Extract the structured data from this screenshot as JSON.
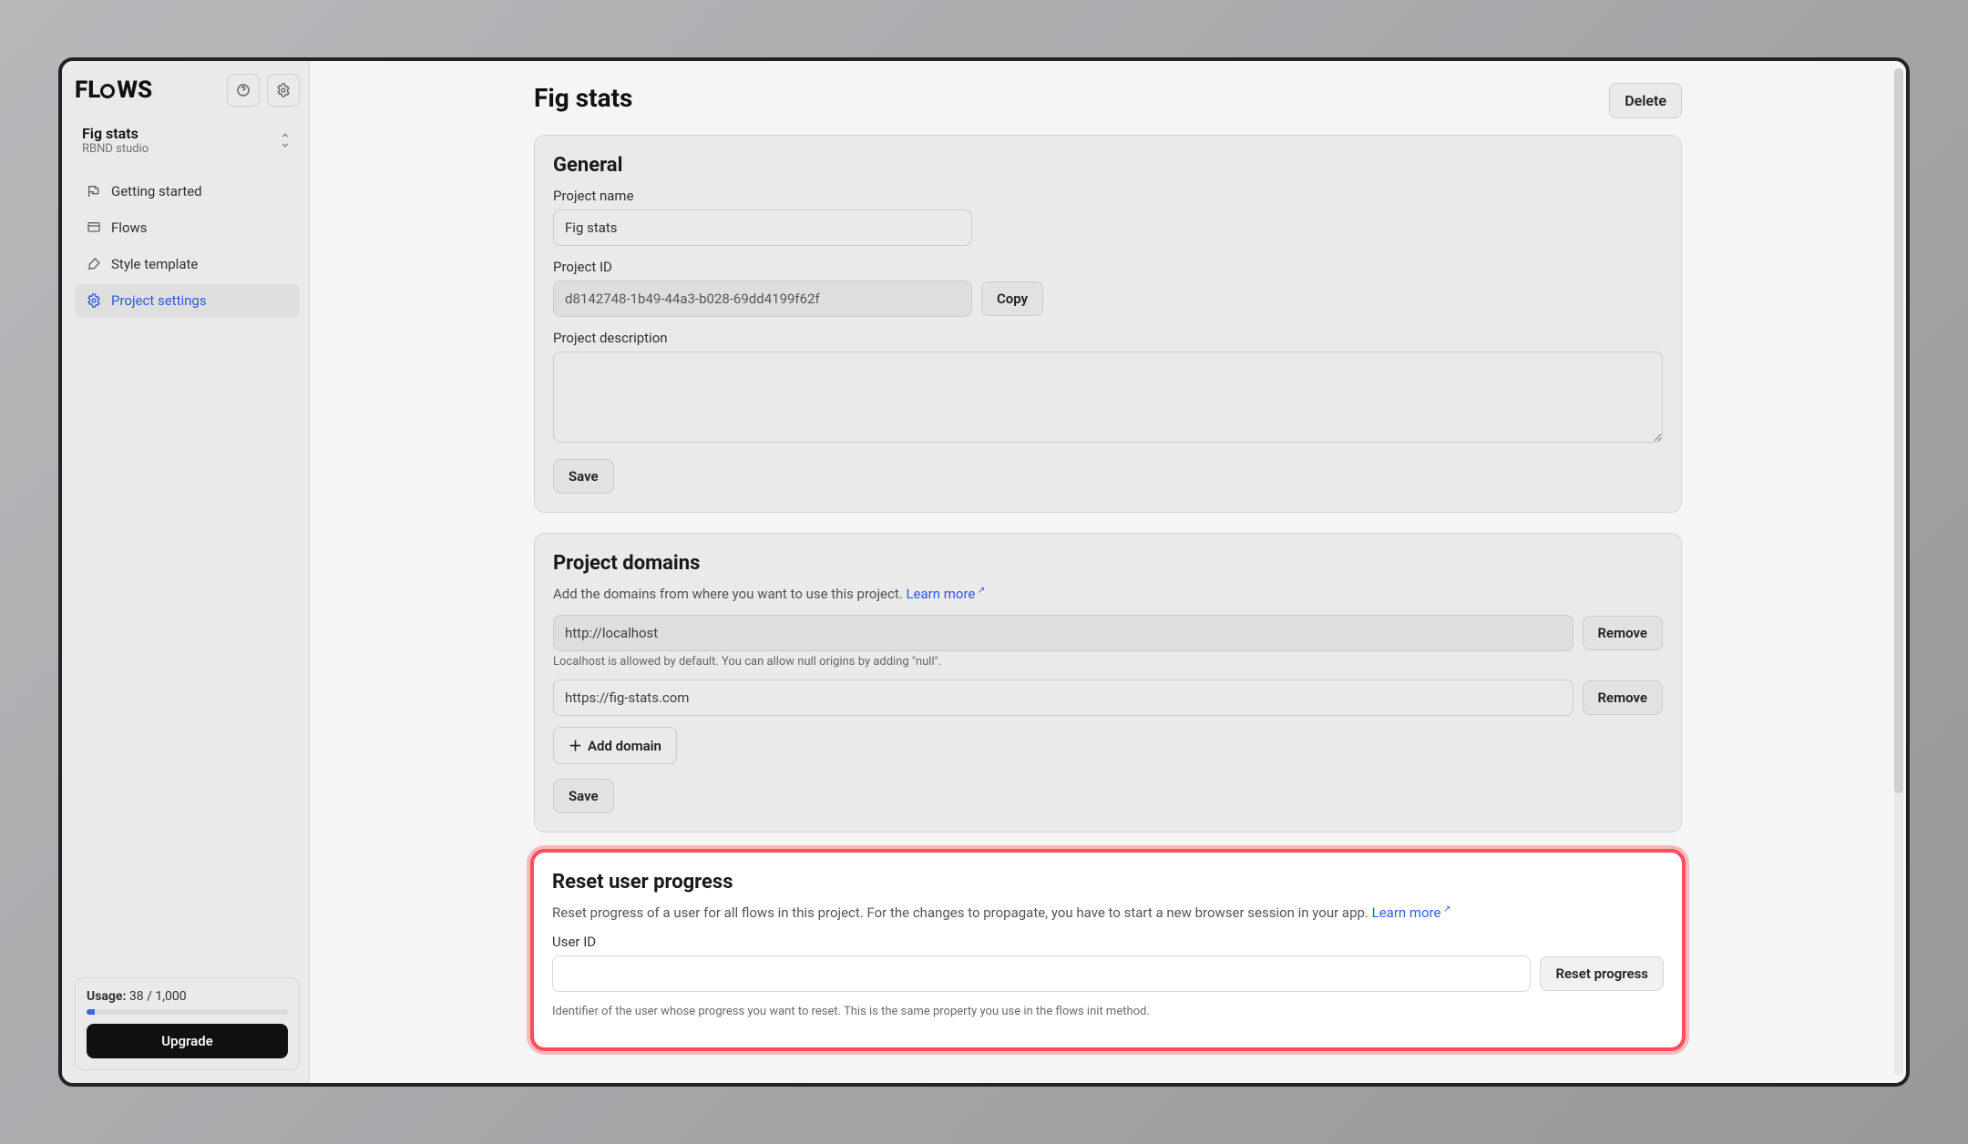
{
  "logo_text": "FL   WS",
  "project_selector": {
    "name": "Fig stats",
    "org": "RBND studio"
  },
  "nav": {
    "items": [
      {
        "label": "Getting started"
      },
      {
        "label": "Flows"
      },
      {
        "label": "Style template"
      },
      {
        "label": "Project settings"
      }
    ]
  },
  "usage": {
    "label_prefix": "Usage:",
    "value": "38 / 1,000",
    "upgrade_label": "Upgrade"
  },
  "page": {
    "title": "Fig stats",
    "delete_label": "Delete"
  },
  "general": {
    "title": "General",
    "name_label": "Project name",
    "name_value": "Fig stats",
    "id_label": "Project ID",
    "id_value": "d8142748-1b49-44a3-b028-69dd4199f62f",
    "copy_label": "Copy",
    "desc_label": "Project description",
    "desc_value": "",
    "save_label": "Save"
  },
  "domains": {
    "title": "Project domains",
    "subtext": "Add the domains from where you want to use this project.",
    "learn_more": "Learn more",
    "rows": [
      {
        "value": "http://localhost",
        "help": "Localhost is allowed by default. You can allow null origins by adding \"null\"."
      },
      {
        "value": "https://fig-stats.com",
        "help": ""
      }
    ],
    "remove_label": "Remove",
    "add_label": "Add domain",
    "save_label": "Save"
  },
  "reset": {
    "title": "Reset user progress",
    "subtext": "Reset progress of a user for all flows in this project. For the changes to propagate, you have to start a new browser session in your app.",
    "learn_more": "Learn more",
    "user_id_label": "User ID",
    "user_id_value": "",
    "button_label": "Reset progress",
    "help": "Identifier of the user whose progress you want to reset. This is the same property you use in the flows init method."
  }
}
